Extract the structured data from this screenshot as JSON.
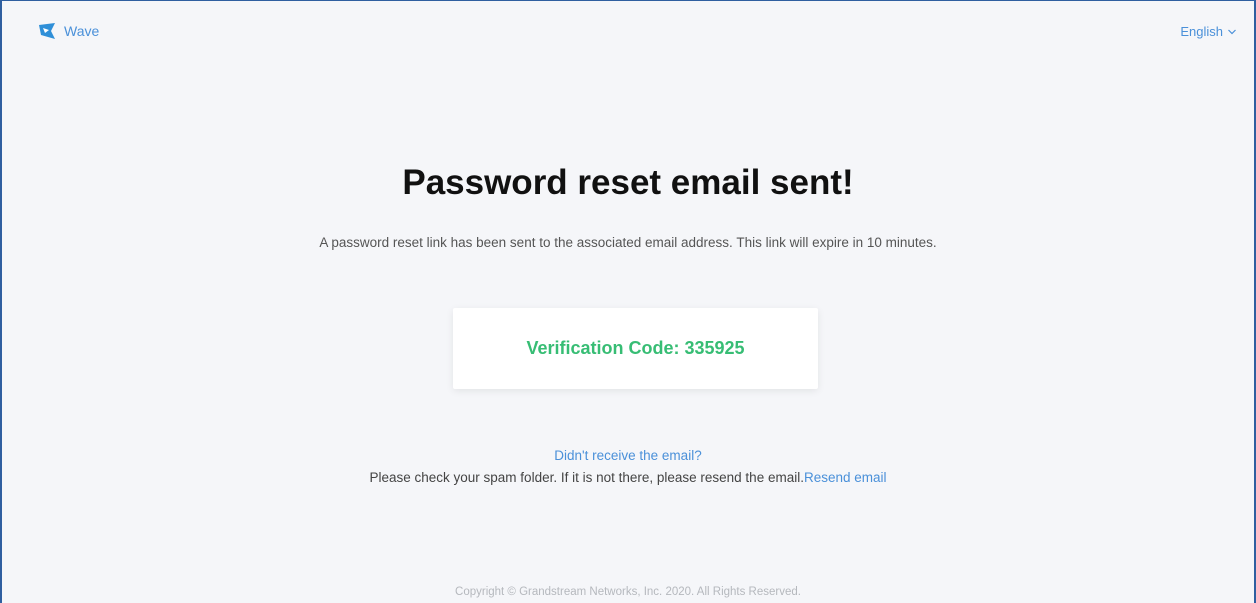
{
  "header": {
    "brand_name": "Wave",
    "brand_icon": "wave-logo-icon",
    "language": "English",
    "language_icon": "chevron-down-icon"
  },
  "main": {
    "title": "Password reset email sent!",
    "message": "A password reset link has been sent to the associated email address. This link will expire in 10 minutes.",
    "verification_label": "Verification Code: ",
    "verification_code": "335925",
    "help_question": "Didn't receive the email?",
    "help_text": "Please check your spam folder. If it is not there, please resend the email.",
    "resend_label": "Resend email"
  },
  "footer": {
    "copyright": "Copyright © Grandstream Networks, Inc. 2020. All Rights Reserved."
  },
  "colors": {
    "accent": "#4a90d9",
    "code": "#37bd74",
    "background": "#f5f6f9"
  }
}
